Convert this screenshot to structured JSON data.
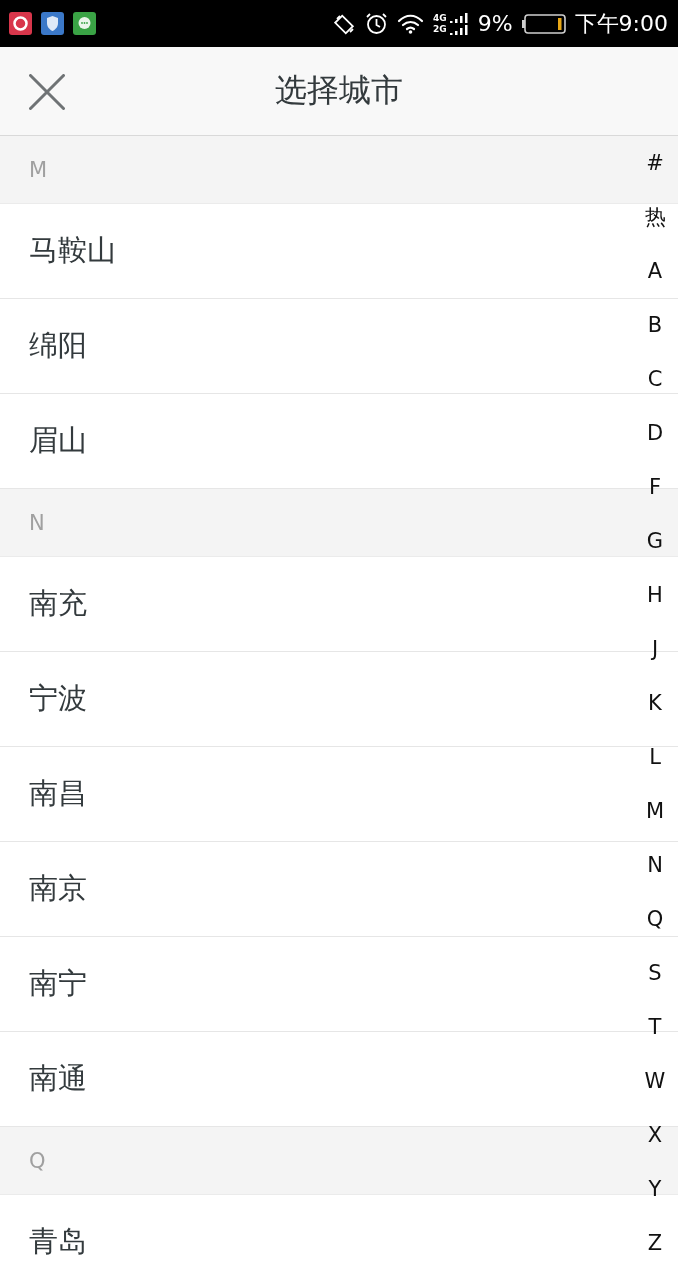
{
  "status_bar": {
    "network_labels": [
      "4G",
      "2G"
    ],
    "battery_text": "9%",
    "time": "下午9:00"
  },
  "header": {
    "title": "选择城市"
  },
  "sections": [
    {
      "letter": "M",
      "cities": [
        "马鞍山",
        "绵阳",
        "眉山"
      ]
    },
    {
      "letter": "N",
      "cities": [
        "南充",
        "宁波",
        "南昌",
        "南京",
        "南宁",
        "南通"
      ]
    },
    {
      "letter": "Q",
      "cities": [
        "青岛"
      ]
    }
  ],
  "index": [
    "#",
    "热",
    "A",
    "B",
    "C",
    "D",
    "F",
    "G",
    "H",
    "J",
    "K",
    "L",
    "M",
    "N",
    "Q",
    "S",
    "T",
    "W",
    "X",
    "Y",
    "Z"
  ]
}
